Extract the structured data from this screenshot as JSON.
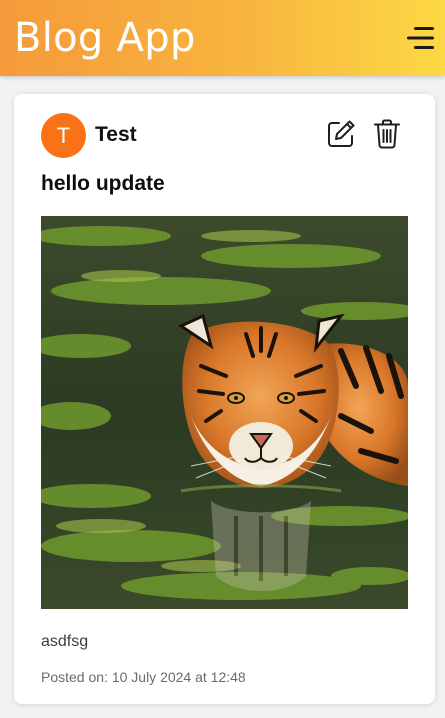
{
  "header": {
    "title": "Blog App",
    "menu_icon": "hamburger-menu-icon"
  },
  "post": {
    "avatar_initial": "T",
    "author": "Test",
    "title": "hello update",
    "image_alt": "tiger",
    "body": "asdfsg",
    "posted_on": "Posted on: 10 July 2024 at 12:48",
    "edit_icon": "edit-icon",
    "delete_icon": "trash-icon"
  },
  "colors": {
    "header_gradient_start": "#f59a3b",
    "header_gradient_end": "#fcd944",
    "avatar_bg": "#f97316",
    "background": "#f1f2f4",
    "card": "#ffffff"
  }
}
